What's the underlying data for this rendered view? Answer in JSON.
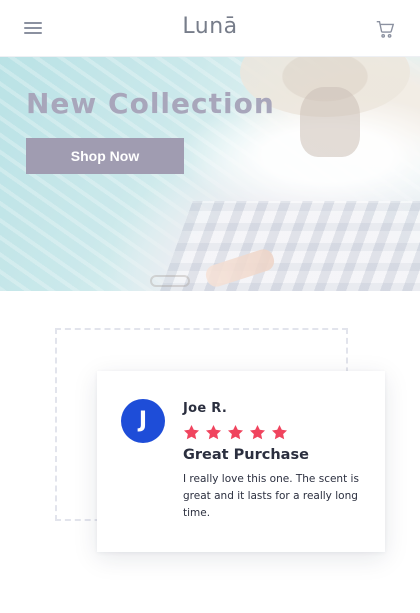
{
  "header": {
    "logo_text": "Lunā",
    "menu_icon": "hamburger-icon",
    "cart_icon": "cart-icon"
  },
  "hero": {
    "title": "New Collection",
    "button_label": "Shop Now"
  },
  "review": {
    "avatar_initial": "J",
    "reviewer_name": "Joe R.",
    "rating": 5,
    "title": "Great Purchase",
    "body": "I really love this one. The scent is great and it lasts for a really long time."
  },
  "colors": {
    "accent_button": "#a09cb1",
    "avatar_bg": "#1e4dd8",
    "star": "#f0445e"
  }
}
